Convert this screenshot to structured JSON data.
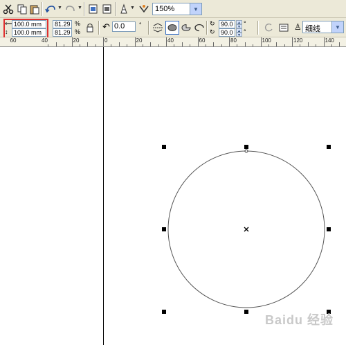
{
  "toolbar1": {
    "icons": [
      "cut-icon",
      "copy-icon",
      "paste-icon",
      "undo-icon",
      "redo-icon",
      "import-icon",
      "export-icon",
      "launch-icon",
      "corel-online-icon"
    ],
    "zoom_value": "150%"
  },
  "toolbar2": {
    "width_value": "100.0 mm",
    "height_value": "100.0 mm",
    "scale_x": "81.29",
    "scale_y": "81.29",
    "percent_symbol": "%",
    "rotation_value": "0.0",
    "degree_symbol": "°",
    "start_angle": "90.0",
    "end_angle": "90.0",
    "outline_width": "细线"
  },
  "ruler": {
    "labels": [
      "60",
      "40",
      "20",
      "0",
      "20",
      "40",
      "60",
      "80",
      "100",
      "120",
      "140"
    ]
  },
  "watermark": "Baidu 经验"
}
